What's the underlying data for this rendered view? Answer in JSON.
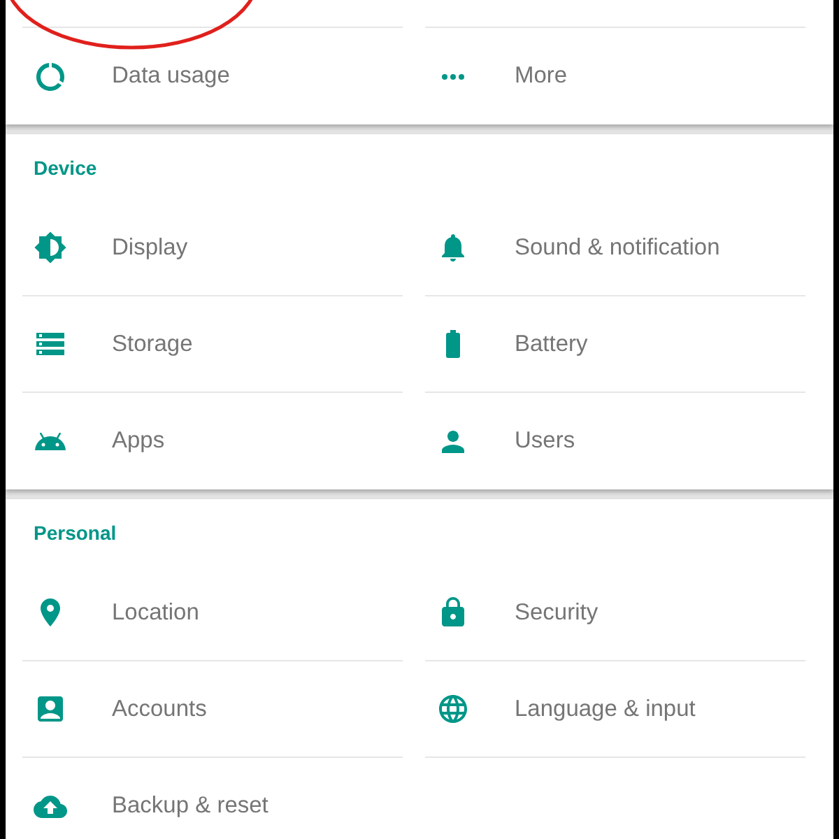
{
  "sections": [
    {
      "items": [
        {
          "label": "Data usage"
        },
        {
          "label": "More"
        }
      ]
    },
    {
      "title": "Device",
      "items": [
        {
          "label": "Display"
        },
        {
          "label": "Sound & notification"
        },
        {
          "label": "Storage"
        },
        {
          "label": "Battery"
        },
        {
          "label": "Apps"
        },
        {
          "label": "Users"
        }
      ]
    },
    {
      "title": "Personal",
      "items": [
        {
          "label": "Location"
        },
        {
          "label": "Security"
        },
        {
          "label": "Accounts"
        },
        {
          "label": "Language & input"
        },
        {
          "label": "Backup & reset"
        }
      ]
    }
  ]
}
